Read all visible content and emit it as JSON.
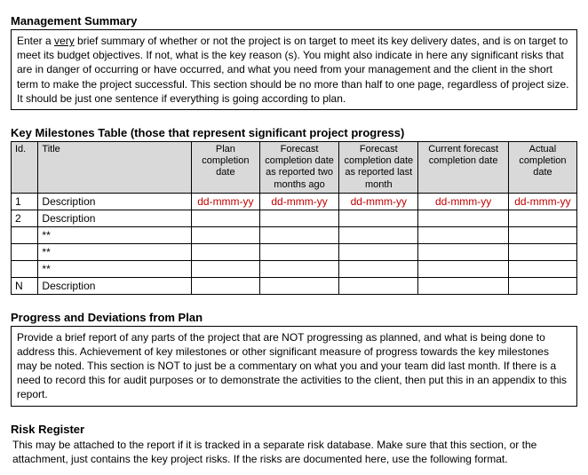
{
  "sections": {
    "mgmt_heading": "Management Summary",
    "mgmt_body_pre": "Enter a ",
    "mgmt_body_underline": "very",
    "mgmt_body_post": " brief summary of whether or not the project is on target to meet its key delivery dates, and is on target to meet its budget objectives.   If not, what is the key reason (s).  You might also indicate in here any significant risks that are in danger of occurring or have occurred, and what you need from your management and the client in the short term to make the project successful.  This section should be no more than half to one page, regardless of project size.  It should be just one sentence if everything is going according to plan.",
    "milestones_heading": "Key Milestones Table (those that represent significant project progress)",
    "progress_heading": "Progress and Deviations from Plan",
    "progress_body": "Provide a brief report of any parts of the project that are NOT progressing as planned, and what is being done to address this.  Achievement of key milestones or other significant measure of progress towards the key milestones may be noted.  This section is NOT to just be a commentary on what you and your team did last month.  If there is a need to record this for audit purposes or to demonstrate the activities to the client, then put this in an appendix to this report.",
    "risk_heading": "Risk Register",
    "risk_body": "This may be attached to the report if it is tracked in a separate risk database.  Make sure that this section, or the attachment, just contains the key project risks.  If the risks are documented here, use the following format."
  },
  "table": {
    "headers": {
      "id": "Id.",
      "title": "Title",
      "plan": "Plan completion date",
      "f2": "Forecast completion date as reported two months ago",
      "f1": "Forecast completion date as reported last month",
      "curr": "Current forecast completion date",
      "actual": "Actual completion date"
    },
    "rows": [
      {
        "id": "1",
        "title": "Description",
        "c1": "dd-mmm-yy",
        "c2": "dd-mmm-yy",
        "c3": "dd-mmm-yy",
        "c4": "dd-mmm-yy",
        "c5": "dd-mmm-yy"
      },
      {
        "id": "2",
        "title": "Description",
        "c1": "",
        "c2": "",
        "c3": "",
        "c4": "",
        "c5": ""
      },
      {
        "id": "",
        "title": "**",
        "c1": "",
        "c2": "",
        "c3": "",
        "c4": "",
        "c5": ""
      },
      {
        "id": "",
        "title": "**",
        "c1": "",
        "c2": "",
        "c3": "",
        "c4": "",
        "c5": ""
      },
      {
        "id": "",
        "title": "**",
        "c1": "",
        "c2": "",
        "c3": "",
        "c4": "",
        "c5": ""
      },
      {
        "id": "N",
        "title": "Description",
        "c1": "",
        "c2": "",
        "c3": "",
        "c4": "",
        "c5": ""
      }
    ]
  }
}
